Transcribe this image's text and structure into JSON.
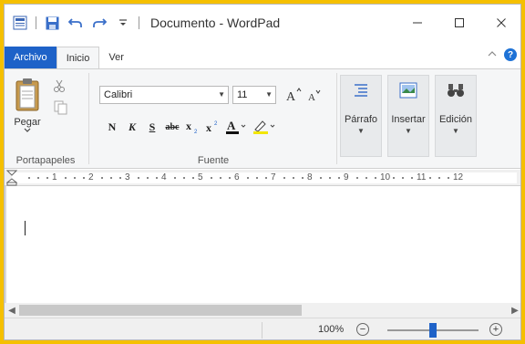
{
  "window": {
    "title": "Documento - WordPad"
  },
  "quick_access": {
    "icons": [
      "app-icon",
      "save-icon",
      "undo-icon",
      "redo-icon",
      "customize-icon"
    ]
  },
  "tabs": {
    "file": "Archivo",
    "items": [
      "Inicio",
      "Ver"
    ],
    "active": "Inicio"
  },
  "ribbon": {
    "clipboard": {
      "paste": "Pegar",
      "label": "Portapapeles"
    },
    "font": {
      "family": "Calibri",
      "size": "11",
      "bold": "N",
      "italic": "K",
      "underline": "S",
      "strike": "abc",
      "label": "Fuente"
    },
    "paragraph": "Párrafo",
    "insert": "Insertar",
    "edit": "Edición"
  },
  "ruler": {
    "numbers": [
      "1",
      "2",
      "3",
      "4",
      "5",
      "6",
      "7",
      "8",
      "9",
      "10",
      "11",
      "12"
    ]
  },
  "status": {
    "zoom": "100%",
    "zoom_level": 0.5
  },
  "colors": {
    "accent": "#1e62c8",
    "frame": "#f5c000"
  }
}
